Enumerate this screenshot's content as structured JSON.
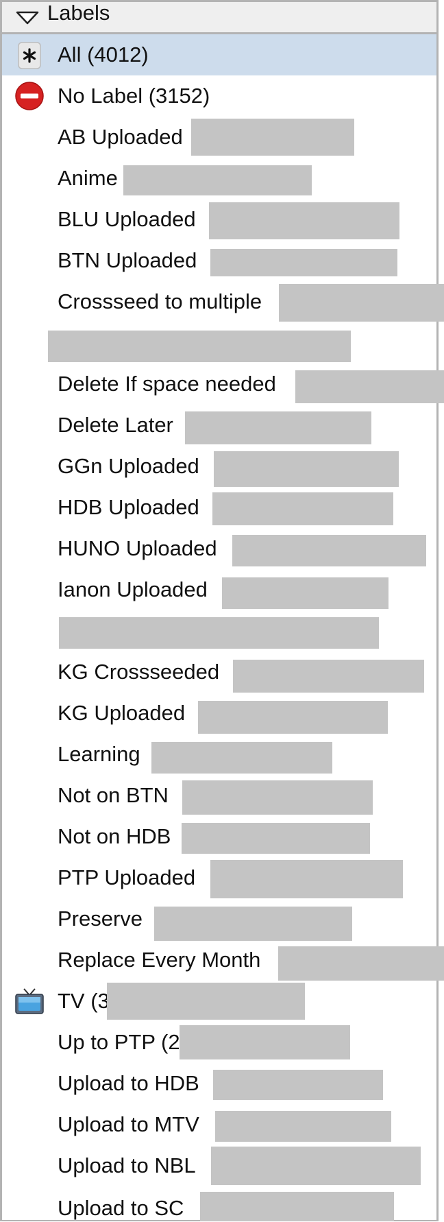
{
  "header": {
    "title": "Labels"
  },
  "labels": [
    {
      "text": "All (4012)",
      "icon": "asterisk-icon"
    },
    {
      "text": "No Label (3152)",
      "icon": "no-entry-icon"
    },
    {
      "text": "AB Uploaded"
    },
    {
      "text": "Anime"
    },
    {
      "text": "BLU Uploaded"
    },
    {
      "text": "BTN Uploaded"
    },
    {
      "text": "Crossseed to multiple"
    },
    {
      "text": ""
    },
    {
      "text": "Delete If space needed"
    },
    {
      "text": "Delete Later"
    },
    {
      "text": "GGn Uploaded"
    },
    {
      "text": "HDB Uploaded"
    },
    {
      "text": "HUNO Uploaded"
    },
    {
      "text": "Ianon Uploaded"
    },
    {
      "text": ""
    },
    {
      "text": "KG Crossseeded"
    },
    {
      "text": "KG Uploaded"
    },
    {
      "text": "Learning"
    },
    {
      "text": "Not on BTN"
    },
    {
      "text": "Not on HDB"
    },
    {
      "text": "PTP Uploaded"
    },
    {
      "text": "Preserve"
    },
    {
      "text": "Replace Every Month"
    },
    {
      "text": "TV (3",
      "icon": "tv-icon"
    },
    {
      "text": "Up to PTP (2"
    },
    {
      "text": "Upload to HDB"
    },
    {
      "text": "Upload to MTV"
    },
    {
      "text": "Upload to NBL"
    },
    {
      "text": "Upload to SC"
    }
  ],
  "colors": {
    "selected_row": "#cddcec",
    "redaction": "#c4c4c4",
    "header_bg": "#efefef"
  }
}
